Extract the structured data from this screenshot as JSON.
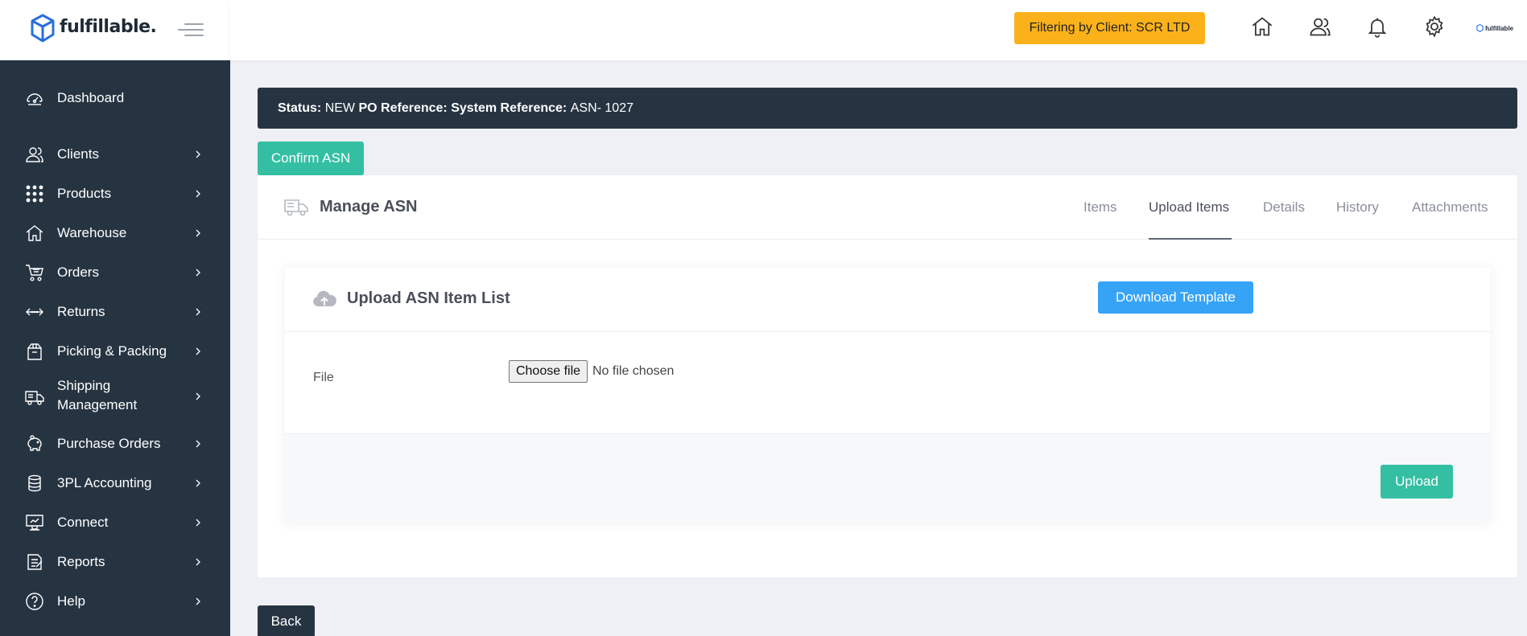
{
  "brand": {
    "name": "fulfillable.",
    "small_logo_text": "fulfillable"
  },
  "sidebar": {
    "items": [
      {
        "label": "Dashboard",
        "icon": "dashboard-icon",
        "has_submenu": false
      },
      {
        "label": "Clients",
        "icon": "users-icon",
        "has_submenu": true
      },
      {
        "label": "Products",
        "icon": "grid-dots-icon",
        "has_submenu": true
      },
      {
        "label": "Warehouse",
        "icon": "home-icon",
        "has_submenu": true
      },
      {
        "label": "Orders",
        "icon": "cart-icon",
        "has_submenu": true
      },
      {
        "label": "Returns",
        "icon": "arrows-icon",
        "has_submenu": true
      },
      {
        "label": "Picking & Packing",
        "icon": "box-icon",
        "has_submenu": true
      },
      {
        "label": "Shipping\nManagement",
        "icon": "truck-icon",
        "has_submenu": true
      },
      {
        "label": "Purchase Orders",
        "icon": "piggy-bank-icon",
        "has_submenu": true
      },
      {
        "label": "3PL Accounting",
        "icon": "coins-icon",
        "has_submenu": true
      },
      {
        "label": "Connect",
        "icon": "monitor-icon",
        "has_submenu": true
      },
      {
        "label": "Reports",
        "icon": "report-icon",
        "has_submenu": true
      },
      {
        "label": "Help",
        "icon": "help-icon",
        "has_submenu": true
      }
    ]
  },
  "topbar": {
    "client_filter": "Filtering by Client: SCR LTD",
    "icons": [
      "home-icon",
      "user-icon",
      "bell-icon",
      "gear-icon"
    ]
  },
  "status_bar": {
    "status_label": "Status:",
    "status_value": "NEW",
    "po_label": "PO Reference:",
    "po_value": "",
    "system_label": "System Reference:",
    "system_value": "ASN- 1027"
  },
  "actions": {
    "confirm_label": "Confirm ASN",
    "back_label": "Back"
  },
  "card": {
    "title": "Manage ASN",
    "tabs": [
      {
        "label": "Items",
        "active": false
      },
      {
        "label": "Upload Items",
        "active": true
      },
      {
        "label": "Details",
        "active": false
      },
      {
        "label": "History",
        "active": false
      },
      {
        "label": "Attachments",
        "active": false
      }
    ]
  },
  "upload": {
    "title": "Upload ASN Item List",
    "download_label": "Download Template",
    "file_label": "File",
    "choose_label": "Choose file",
    "no_file_text": "No file chosen",
    "upload_label": "Upload"
  },
  "colors": {
    "sidebar_bg": "#263442",
    "accent_green": "#34bfa3",
    "accent_blue": "#36a3f7",
    "filter_yellow": "#fbb21a",
    "brand_blue": "#2a6fe0"
  }
}
